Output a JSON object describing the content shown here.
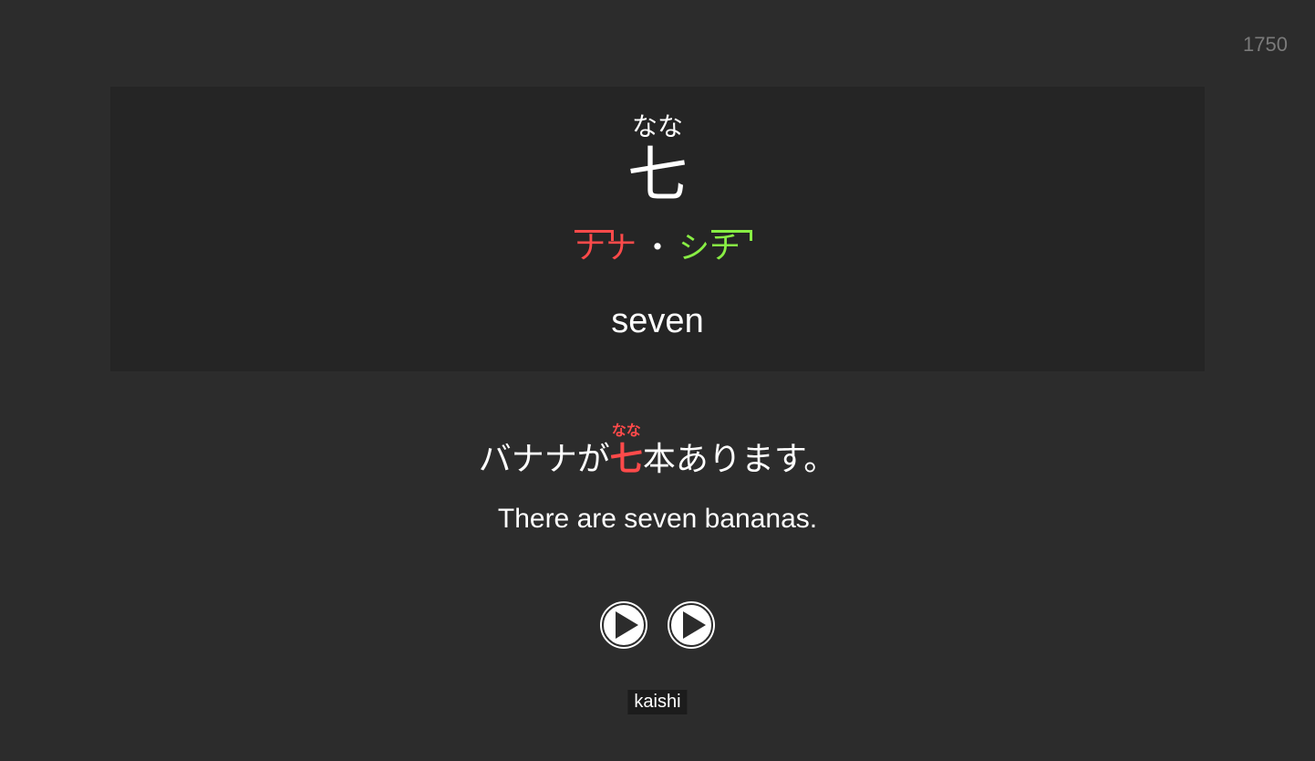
{
  "card": {
    "id": "1750"
  },
  "front": {
    "kanji_reading": "なな",
    "kanji": "七",
    "onyomi_1": "ナナ",
    "separator": "・",
    "onyomi_2": "シチ",
    "meaning": "seven"
  },
  "example": {
    "before": "バナナが",
    "target": "七",
    "target_reading": "なな",
    "after": "本あります。",
    "translation": "There are seven bananas."
  },
  "audio": {
    "icon": "play-icon"
  },
  "tags": [
    "kaishi"
  ],
  "colors": {
    "background": "#2c2c2c",
    "panel": "#252525",
    "accent_red": "#ff4a4a",
    "accent_green": "#88ee44"
  }
}
